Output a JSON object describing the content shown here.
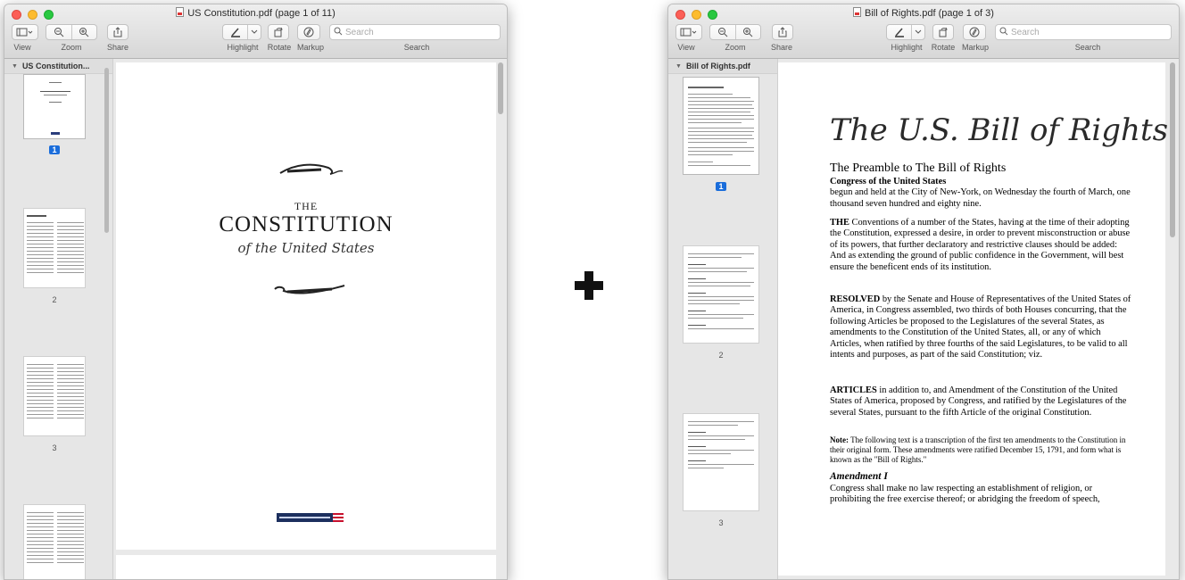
{
  "window_left": {
    "title": "US Constitution.pdf (page 1 of 11)",
    "toolbar": {
      "view_label": "View",
      "zoom_label": "Zoom",
      "share_label": "Share",
      "highlight_label": "Highlight",
      "rotate_label": "Rotate",
      "markup_label": "Markup",
      "search_label": "Search",
      "search_placeholder": "Search"
    },
    "sidebar": {
      "doc_name": "US Constitution...",
      "pages": [
        "1",
        "2",
        "3"
      ],
      "selected_page": "1"
    },
    "page": {
      "pre_title": "THE",
      "title": "CONSTITUTION",
      "subtitle": "of the United States"
    }
  },
  "plus_sign": "+",
  "window_right": {
    "title": "Bill of Rights.pdf (page 1 of 3)",
    "toolbar": {
      "view_label": "View",
      "zoom_label": "Zoom",
      "share_label": "Share",
      "highlight_label": "Highlight",
      "rotate_label": "Rotate",
      "markup_label": "Markup",
      "search_label": "Search",
      "search_placeholder": "Search"
    },
    "sidebar": {
      "doc_name": "Bill of Rights.pdf",
      "pages": [
        "1",
        "2",
        "3"
      ],
      "selected_page": "1"
    },
    "page": {
      "title": "The U.S. Bill of Rights",
      "preamble_heading": "The Preamble to The Bill of Rights",
      "congress_heading": "Congress of the United States",
      "congress_text": "begun and held at the City of New-York, on Wednesday the fourth of March, one thousand seven hundred and eighty nine.",
      "p1_lead": "THE",
      "p1_text": " Conventions of a number of the States, having at the time of their adopting the Constitution, expressed a desire, in order to prevent misconstruction or abuse of its powers, that further declaratory and restrictive clauses should be added: And as extending the ground of public confidence in the Government, will best ensure the beneficent ends of its institution.",
      "p2_lead": "RESOLVED",
      "p2_text": " by the Senate and House of Representatives of the United States of America, in Congress assembled, two thirds of both Houses concurring, that the following Articles be proposed to the Legislatures of the several States, as amendments to the Constitution of the United States, all, or any of which Articles, when ratified by three fourths of the said Legislatures, to be valid to all intents and purposes, as part of the said Constitution; viz.",
      "p3_lead": "ARTICLES",
      "p3_text": " in addition to, and Amendment of the Constitution of the United States of America, proposed by Congress, and ratified by the Legislatures of the several States, pursuant to the fifth Article of the original Constitution.",
      "note_lead": "Note:",
      "note_text": " The following text is a transcription of the first ten amendments to the Constitution in their original form. These amendments were ratified December 15, 1791, and form what is known as the \"Bill of Rights.\"",
      "amend_heading": "Amendment I",
      "amend_text": "Congress shall make no law respecting an establishment of religion, or prohibiting the free exercise thereof; or abridging the freedom of speech,"
    }
  }
}
